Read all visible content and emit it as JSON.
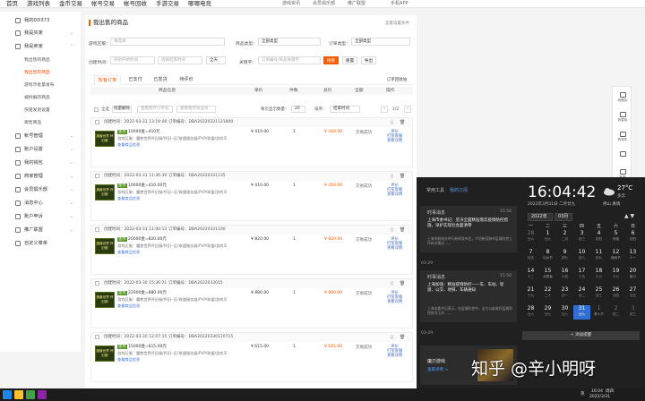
{
  "nav": {
    "main": [
      "首页",
      "游戏列表",
      "金币交易",
      "帐号交易",
      "帐号回收",
      "手游交易",
      "哪哪电竞"
    ],
    "sub": [
      "游戏资讯",
      "会员俱乐部",
      "推广联盟",
      "",
      "手机APP"
    ]
  },
  "sidebar": {
    "user": "我的DD373",
    "items": [
      {
        "label": "我是买家",
        "type": "group",
        "arrow": "⌄"
      },
      {
        "label": "我是卖家",
        "type": "group",
        "arrow": "⌃"
      },
      {
        "label": "我出售的商品",
        "type": "sub"
      },
      {
        "label": "我出售的商品",
        "type": "sub",
        "active": true
      },
      {
        "label": "游戏币批量发布",
        "type": "sub"
      },
      {
        "label": "被拆解的商品",
        "type": "sub"
      },
      {
        "label": "快速发货设置",
        "type": "sub"
      },
      {
        "label": "寄售商品",
        "type": "sub"
      },
      {
        "label": "帐号管理",
        "type": "group",
        "arrow": "⌄"
      },
      {
        "label": "账户设置",
        "type": "group",
        "arrow": "⌄"
      },
      {
        "label": "我的钱包",
        "type": "group",
        "arrow": "⌄"
      },
      {
        "label": "商家管理",
        "type": "group",
        "arrow": "⌄"
      },
      {
        "label": "会员俱乐部",
        "type": "group",
        "arrow": "⌄"
      },
      {
        "label": "消息中心",
        "type": "group",
        "arrow": "⌄"
      },
      {
        "label": "账户申诉",
        "type": "group",
        "arrow": "⌄"
      },
      {
        "label": "推广联盟",
        "type": "group",
        "arrow": "⌄"
      },
      {
        "label": "自定义菜单",
        "type": "group",
        "arrow": ""
      }
    ]
  },
  "main": {
    "title": "我出售的商品",
    "settings_link": "卖家设置条件",
    "filters": {
      "game_label": "游戏区服：",
      "game_placeholder": "请选择",
      "type_label": "商品类型：",
      "type_value": "全部类型",
      "order_type_label": "订单类型：",
      "order_type_value": "全部类型",
      "date_label": "创建时间：",
      "date_start_placeholder": "开始开始时间",
      "date_end_placeholder": "选择结束时间",
      "date_range": "全天",
      "keyword_label": "关键字：",
      "keyword_placeholder": "订单编号/商品关键字",
      "search_btn": "搜索",
      "reset_btn": "重置",
      "export_btn": "导出"
    },
    "tabs": [
      "所有订单",
      "已支付",
      "已发货",
      "待评价"
    ],
    "history_link": "订单回收站",
    "columns": [
      "商品信息",
      "单价",
      "件数",
      "总价",
      "全部",
      "操作"
    ],
    "bulk": {
      "select_all": "全选",
      "batch_delete": "批量删除",
      "search_order_placeholder": "查看暂存订单号",
      "search_product_placeholder": "查看暂存商品号",
      "per_page_label": "每页显示数量：",
      "per_page": "20",
      "sort_label": "排序：",
      "sort_value": "结束时间",
      "page_indicator": "1/2"
    },
    "orders": [
      {
        "time": "创建时间：2022-03-31 13:19:08",
        "order_no": "订单编号：DBA20220331131800",
        "game": "魔兽世界 怀旧服",
        "tag": "金币",
        "amount": "10000金=410元",
        "desc": "游戏区服：魔兽世界怀旧服/怀旧--区/联盟服务器/PVP/联盟/游戏币",
        "link": "查看商品信息",
        "price": "¥ 410.00",
        "qty": "1",
        "total": "¥ 410.00",
        "status": "交易成功",
        "ops": [
          "评价",
          "打赏客服",
          "查看详情"
        ]
      },
      {
        "time": "创建时间：2022-03-31 11:36:39",
        "order_no": "订单编号：DBA20220331135",
        "game": "魔兽世界 怀旧服",
        "tag": "金币",
        "amount": "10000金=410.00元",
        "desc": "游戏区服：魔兽世界怀旧服/怀旧--区/联盟服务器/PVP/联盟/游戏币",
        "link": "查看商品信息",
        "price": "¥ 410.00",
        "qty": "1",
        "total": "¥ 410.00",
        "status": "交易成功",
        "ops": [
          "评价",
          "打赏客服",
          "查看详情"
        ]
      },
      {
        "time": "创建时间：2022-03-31 11:00:13",
        "order_no": "订单编号：DBA20220331100",
        "game": "魔兽世界 怀旧服",
        "tag": "金币",
        "amount": "20000金=820.00元",
        "desc": "游戏区服：魔兽世界怀旧服/怀旧--区/联盟服务器/PVP/联盟/游戏币",
        "link": "查看商品信息",
        "price": "¥ 820.00",
        "qty": "1",
        "total": "¥ 820.00",
        "status": "交易成功",
        "ops": [
          "评价",
          "打赏客服",
          "查看详情"
        ]
      },
      {
        "time": "创建时间：2022-03-30 15:36:21",
        "order_no": "订单编号：DBA2022033015",
        "game": "魔兽世界 怀旧服",
        "tag": "金币",
        "amount": "22000金=880.00元",
        "desc": "游戏区服：魔兽世界怀旧服/怀旧--区/联盟服务器/PVP/联盟/游戏币",
        "link": "查看商品信息",
        "price": "¥ 880.00",
        "qty": "1",
        "total": "¥ 880.00",
        "status": "交易成功",
        "ops": [
          "评价",
          "打赏客服",
          "查看详情"
        ]
      },
      {
        "time": "创建时间：2022-03-30 12:07:15",
        "order_no": "订单编号：DBA20220330120715",
        "game": "魔兽世界 怀旧服",
        "tag": "金币",
        "amount": "15000金=615.00元",
        "desc": "游戏区服：魔兽世界怀旧服/怀旧--区/联盟服务器/PVP/联盟/游戏币",
        "link": "查看商品信息",
        "price": "¥ 615.00",
        "qty": "1",
        "total": "¥ 615.00",
        "status": "交易成功",
        "ops": [
          "评价",
          "打赏客服",
          "查看详情"
        ]
      }
    ]
  },
  "right_toolbar": [
    "我要买",
    "我要卖",
    "购物车",
    "",
    "客服"
  ],
  "panel": {
    "tabs": [
      "常用工具",
      "我的订阅"
    ],
    "news": [
      {
        "head": "时事消息",
        "time": "15:50",
        "body": "上海市委书记：坚决全面精准落实疫情防控措施，早护实现社会面清零",
        "summary": "上海市新闻办举行新闻发布会，介绍新冠肺炎疫情防控工作有关情况……",
        "date": "03-29"
      },
      {
        "head": "时事消息",
        "time": "15:50",
        "body": "上海加强：精准疫情防控——车、车站、轮渡、公交、地铁、车辆通知",
        "summary": "上海市委书记表示，在疫情防控中，全力以赴做好疫情防控各项工作……",
        "date": "03-29"
      }
    ],
    "clock": "16:04:42",
    "date_line": "2022年3月31日 二月廿九",
    "weather_temp": "27°C",
    "weather_desc": "多云",
    "weather_loc": "佛山 真情",
    "year_sel": "2022年",
    "month_sel": "03月",
    "weekdays": [
      "一",
      "二",
      "三",
      "四",
      "五",
      "六",
      "日"
    ],
    "days": [
      [
        "28",
        "廿六",
        "off"
      ],
      [
        "1",
        "廿九",
        ""
      ],
      [
        "2",
        "二月",
        ""
      ],
      [
        "3",
        "初三",
        ""
      ],
      [
        "4",
        "初四",
        ""
      ],
      [
        "5",
        "惊蛰",
        ""
      ],
      [
        "6",
        "初四",
        ""
      ],
      [
        "7",
        "初五",
        ""
      ],
      [
        "8",
        "妇女节",
        ""
      ],
      [
        "9",
        "初七",
        ""
      ],
      [
        "10",
        "初八",
        ""
      ],
      [
        "11",
        "初九",
        ""
      ],
      [
        "12",
        "植树节",
        ""
      ],
      [
        "13",
        "十一",
        ""
      ],
      [
        "14",
        "十二",
        ""
      ],
      [
        "15",
        "消费者",
        ""
      ],
      [
        "16",
        "十四",
        ""
      ],
      [
        "17",
        "十五",
        ""
      ],
      [
        "18",
        "十六",
        ""
      ],
      [
        "19",
        "十七",
        ""
      ],
      [
        "20",
        "春分",
        ""
      ],
      [
        "21",
        "十九",
        ""
      ],
      [
        "22",
        "二十",
        ""
      ],
      [
        "23",
        "廿一",
        ""
      ],
      [
        "24",
        "廿二",
        ""
      ],
      [
        "25",
        "廿三",
        ""
      ],
      [
        "26",
        "廿四",
        ""
      ],
      [
        "27",
        "廿五",
        ""
      ],
      [
        "28",
        "廿六",
        ""
      ],
      [
        "29",
        "廿七",
        ""
      ],
      [
        "30",
        "廿八",
        ""
      ],
      [
        "31",
        "廿九",
        "today"
      ],
      [
        "1",
        "愚人节",
        "off"
      ],
      [
        "2",
        "初二",
        "off"
      ],
      [
        "3",
        "初三",
        "off"
      ]
    ],
    "add_btn": "+ 添加提醒",
    "game_title": "魔刃游戏",
    "game_link": "查看详情 >"
  },
  "taskbar": {
    "time": "16:04",
    "date": "2022/3/31",
    "weekday": "周四",
    "lang": "英"
  },
  "watermark": "知乎 @辛小明呀"
}
